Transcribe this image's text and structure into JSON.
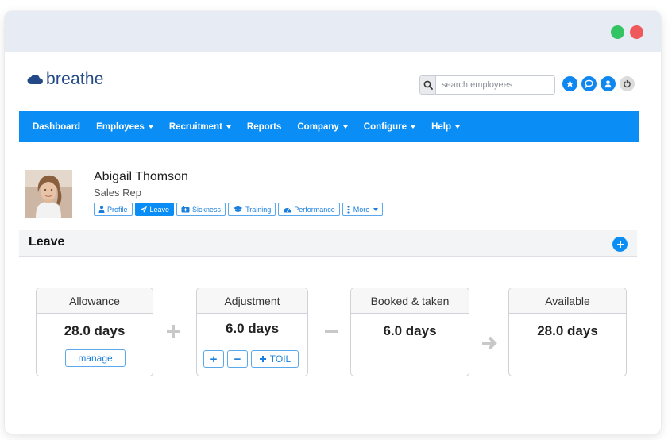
{
  "window": {
    "controls": [
      "green",
      "red"
    ]
  },
  "header": {
    "logo_text": "breathe",
    "search": {
      "placeholder": "search employees",
      "value": ""
    },
    "icons": [
      "star-icon",
      "chat-icon",
      "user-icon",
      "power-icon"
    ]
  },
  "nav": {
    "items": [
      {
        "label": "Dashboard",
        "dropdown": false
      },
      {
        "label": "Employees",
        "dropdown": true
      },
      {
        "label": "Recruitment",
        "dropdown": true
      },
      {
        "label": "Reports",
        "dropdown": false
      },
      {
        "label": "Company",
        "dropdown": true
      },
      {
        "label": "Configure",
        "dropdown": true
      },
      {
        "label": "Help",
        "dropdown": true
      }
    ]
  },
  "profile": {
    "name": "Abigail Thomson",
    "role": "Sales Rep",
    "tabs": [
      {
        "label": "Profile",
        "icon": "person-icon",
        "active": false
      },
      {
        "label": "Leave",
        "icon": "plane-icon",
        "active": true
      },
      {
        "label": "Sickness",
        "icon": "medkit-icon",
        "active": false
      },
      {
        "label": "Training",
        "icon": "graduation-cap-icon",
        "active": false
      },
      {
        "label": "Performance",
        "icon": "gauge-icon",
        "active": false
      },
      {
        "label": "More",
        "icon": "vertical-dots-icon",
        "active": false
      }
    ]
  },
  "section": {
    "title": "Leave"
  },
  "cards": {
    "allowance": {
      "title": "Allowance",
      "value": "28.0 days",
      "button": "manage"
    },
    "adjustment": {
      "title": "Adjustment",
      "value": "6.0 days",
      "buttons": [
        "+",
        "−",
        "TOIL"
      ]
    },
    "booked": {
      "title": "Booked & taken",
      "value": "6.0 days"
    },
    "available": {
      "title": "Available",
      "value": "28.0 days"
    }
  },
  "operators": [
    "plus-icon",
    "minus-icon",
    "arrow-right-icon"
  ],
  "colors": {
    "accent": "#0a8ef5",
    "logo": "#234a86",
    "titlebar": "#e6ebf4"
  }
}
